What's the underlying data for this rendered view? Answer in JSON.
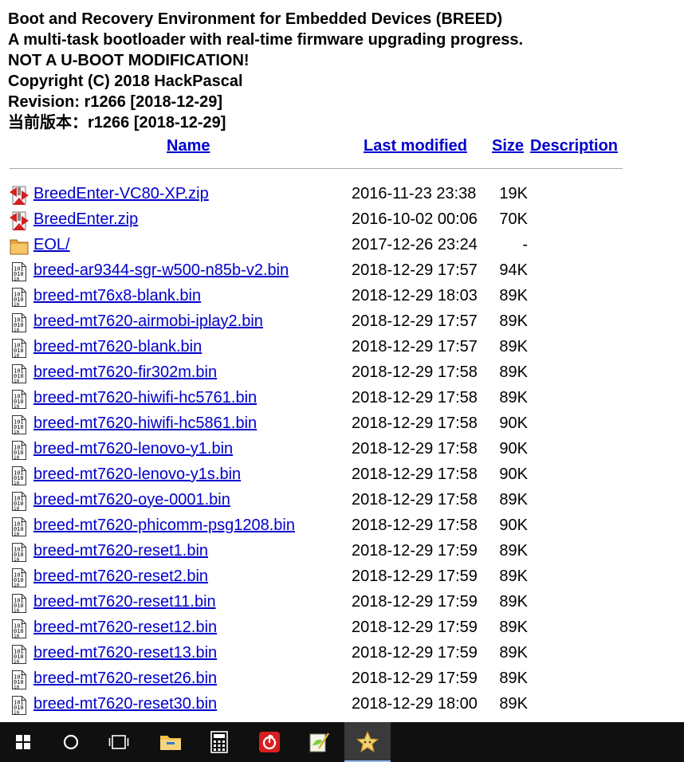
{
  "header": {
    "line1": "Boot and Recovery Environment for Embedded Devices (BREED)",
    "line2": "A multi-task bootloader with real-time firmware upgrading progress.",
    "line3": "NOT A U-BOOT MODIFICATION!",
    "line4": "Copyright (C) 2018 HackPascal",
    "line5": "Revision: r1266 [2018-12-29]",
    "line6": "当前版本：r1266 [2018-12-29]"
  },
  "columns": {
    "name": "Name",
    "modified": "Last modified",
    "size": "Size",
    "description": "Description"
  },
  "files": [
    {
      "name": "BreedEnter-VC80-XP.zip",
      "modified": "2016-11-23 23:38",
      "size": "19K",
      "icon": "archive-icon"
    },
    {
      "name": "BreedEnter.zip",
      "modified": "2016-10-02 00:06",
      "size": "70K",
      "icon": "archive-icon"
    },
    {
      "name": "EOL/",
      "modified": "2017-12-26 23:24",
      "size": "-",
      "icon": "folder-icon"
    },
    {
      "name": "breed-ar9344-sgr-w500-n85b-v2.bin",
      "modified": "2018-12-29 17:57",
      "size": "94K",
      "icon": "binary-file-icon"
    },
    {
      "name": "breed-mt76x8-blank.bin",
      "modified": "2018-12-29 18:03",
      "size": "89K",
      "icon": "binary-file-icon"
    },
    {
      "name": "breed-mt7620-airmobi-iplay2.bin",
      "modified": "2018-12-29 17:57",
      "size": "89K",
      "icon": "binary-file-icon"
    },
    {
      "name": "breed-mt7620-blank.bin",
      "modified": "2018-12-29 17:57",
      "size": "89K",
      "icon": "binary-file-icon"
    },
    {
      "name": "breed-mt7620-fir302m.bin",
      "modified": "2018-12-29 17:58",
      "size": "89K",
      "icon": "binary-file-icon"
    },
    {
      "name": "breed-mt7620-hiwifi-hc5761.bin",
      "modified": "2018-12-29 17:58",
      "size": "89K",
      "icon": "binary-file-icon"
    },
    {
      "name": "breed-mt7620-hiwifi-hc5861.bin",
      "modified": "2018-12-29 17:58",
      "size": "90K",
      "icon": "binary-file-icon"
    },
    {
      "name": "breed-mt7620-lenovo-y1.bin",
      "modified": "2018-12-29 17:58",
      "size": "90K",
      "icon": "binary-file-icon"
    },
    {
      "name": "breed-mt7620-lenovo-y1s.bin",
      "modified": "2018-12-29 17:58",
      "size": "90K",
      "icon": "binary-file-icon"
    },
    {
      "name": "breed-mt7620-oye-0001.bin",
      "modified": "2018-12-29 17:58",
      "size": "89K",
      "icon": "binary-file-icon"
    },
    {
      "name": "breed-mt7620-phicomm-psg1208.bin",
      "modified": "2018-12-29 17:58",
      "size": "90K",
      "icon": "binary-file-icon"
    },
    {
      "name": "breed-mt7620-reset1.bin",
      "modified": "2018-12-29 17:59",
      "size": "89K",
      "icon": "binary-file-icon"
    },
    {
      "name": "breed-mt7620-reset2.bin",
      "modified": "2018-12-29 17:59",
      "size": "89K",
      "icon": "binary-file-icon"
    },
    {
      "name": "breed-mt7620-reset11.bin",
      "modified": "2018-12-29 17:59",
      "size": "89K",
      "icon": "binary-file-icon"
    },
    {
      "name": "breed-mt7620-reset12.bin",
      "modified": "2018-12-29 17:59",
      "size": "89K",
      "icon": "binary-file-icon"
    },
    {
      "name": "breed-mt7620-reset13.bin",
      "modified": "2018-12-29 17:59",
      "size": "89K",
      "icon": "binary-file-icon"
    },
    {
      "name": "breed-mt7620-reset26.bin",
      "modified": "2018-12-29 17:59",
      "size": "89K",
      "icon": "binary-file-icon"
    },
    {
      "name": "breed-mt7620-reset30.bin",
      "modified": "2018-12-29 18:00",
      "size": "89K",
      "icon": "binary-file-icon"
    }
  ],
  "colors": {
    "link": "#0000cc",
    "taskbar": "#101010",
    "taskbar_active": "#3a3a3a"
  },
  "taskbar": {
    "items": [
      {
        "icon": "windows-start-icon",
        "active": false
      },
      {
        "icon": "cortana-search-icon",
        "active": false
      },
      {
        "icon": "task-view-icon",
        "active": false
      },
      {
        "icon": "file-explorer-icon",
        "active": false
      },
      {
        "icon": "calculator-icon",
        "active": false
      },
      {
        "icon": "netease-music-icon",
        "active": false
      },
      {
        "icon": "notepad-plus-plus-icon",
        "active": false
      },
      {
        "icon": "star-app-icon",
        "active": true
      }
    ]
  }
}
